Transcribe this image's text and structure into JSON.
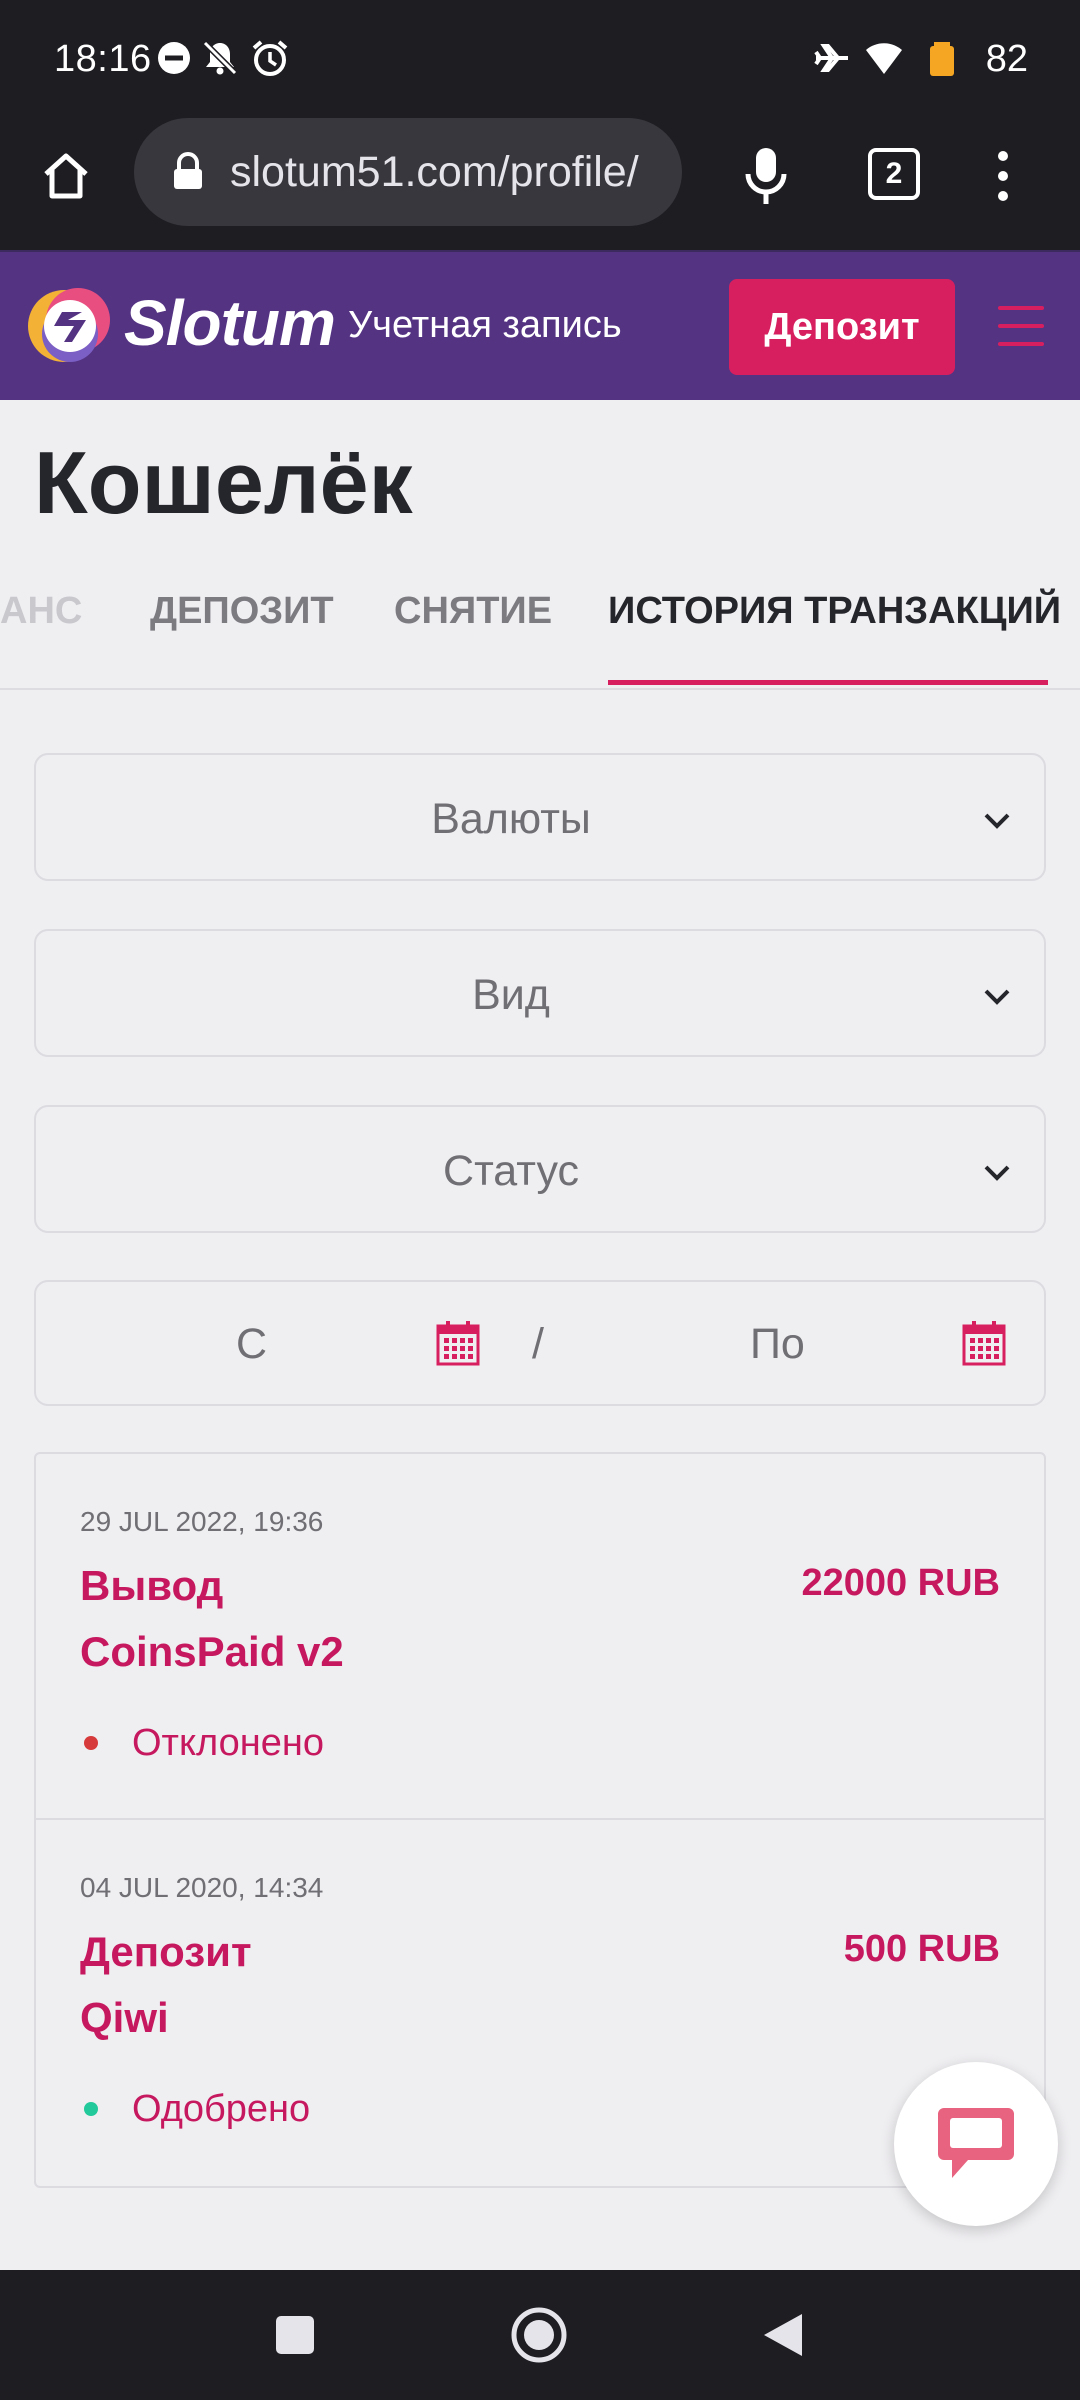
{
  "status_bar": {
    "time": "18:16",
    "battery_level": "82",
    "icons": [
      "do-not-disturb-icon",
      "bell-off-icon",
      "alarm-icon",
      "airplane-icon",
      "wifi-icon",
      "battery-icon"
    ]
  },
  "browser": {
    "url": "slotum51.com/profile/",
    "tab_count": "2"
  },
  "header": {
    "logo_text": "Slotum",
    "account_label": "Учетная запись",
    "deposit_button": "Депозит",
    "brand_color": "#543383",
    "accent_color": "#d71f5f"
  },
  "page": {
    "title": "Кошелёк"
  },
  "tabs": [
    {
      "label": "АНС"
    },
    {
      "label": "ДЕПОЗИТ"
    },
    {
      "label": "СНЯТИЕ"
    },
    {
      "label": "ИСТОРИЯ ТРАНЗАКЦИЙ",
      "active": true
    }
  ],
  "filters": {
    "currencies": "Валюты",
    "type": "Вид",
    "status": "Статус",
    "date_from": "С",
    "date_separator": "/",
    "date_to": "По"
  },
  "transactions": [
    {
      "date": "29 JUL 2022, 19:36",
      "type": "Вывод",
      "method": "CoinsPaid v2",
      "amount": "22000 RUB",
      "status": "Отклонено",
      "status_color": "#d73a3a"
    },
    {
      "date": "04 JUL 2020, 14:34",
      "type": "Депозит",
      "method": "Qiwi",
      "amount": "500 RUB",
      "status": "Одобрено",
      "status_color": "#22c99a"
    }
  ]
}
